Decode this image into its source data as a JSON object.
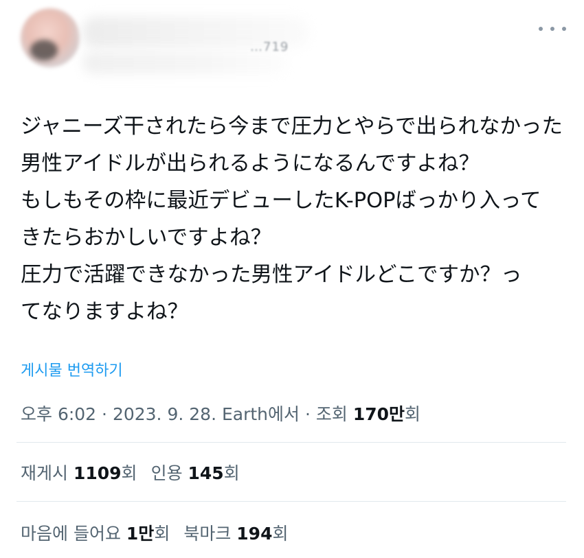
{
  "header": {
    "handle_fragment": "…719"
  },
  "tweet": {
    "lines": [
      "ジャニーズ干されたら今まで圧力とやらで出られなかった",
      "男性アイドルが出られるようになるんですよね？",
      "もしもその枠に最近デビューしたK-POPばっかり入って",
      "きたらおかしいですよね？",
      "圧力で活躍できなかった男性アイドルどこですか？っ",
      "てなりますよね？"
    ]
  },
  "translate_label": "게시물 번역하기",
  "meta": {
    "time": "오후 6:02",
    "sep1": " · ",
    "date": "2023. 9. 28.",
    "source": " Earth에서",
    "sep2": " · ",
    "views_label": "조회 ",
    "views_value": "170만",
    "views_suffix": "회"
  },
  "stats1": {
    "reposts_label": "재게시 ",
    "reposts_value": "1109",
    "reposts_suffix": "회",
    "quotes_label": "인용 ",
    "quotes_value": "145",
    "quotes_suffix": "회"
  },
  "stats2": {
    "likes_label": "마음에 들어요 ",
    "likes_value": "1만",
    "likes_suffix": "회",
    "bookmarks_label": "북마크 ",
    "bookmarks_value": "194",
    "bookmarks_suffix": "회"
  },
  "colors": {
    "link": "#1d9bf0",
    "muted": "#536471",
    "text": "#0f1419",
    "divider": "#e1e8ed"
  },
  "icons": {
    "more": "more-horizontal-icon"
  }
}
